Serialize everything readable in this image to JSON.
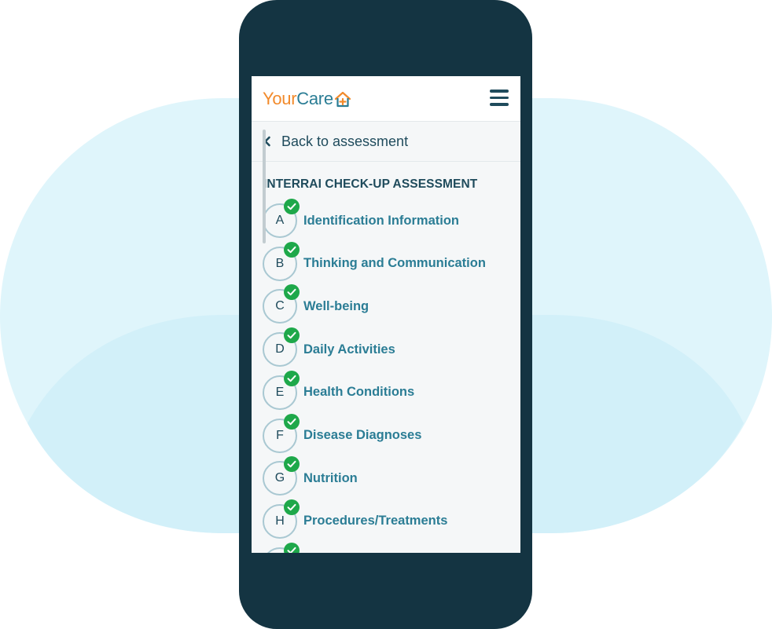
{
  "header": {
    "logo_text_part1": "Your",
    "logo_text_part2": "Care",
    "logo_icon": "house-plus-icon",
    "menu_icon": "hamburger-menu-icon"
  },
  "nav": {
    "back_label": "Back to assessment",
    "back_icon": "chevron-left-icon"
  },
  "assessment": {
    "title": "INTERRAI CHECK-UP ASSESSMENT",
    "sections": [
      {
        "letter": "A",
        "label": "Identification Information",
        "completed": true
      },
      {
        "letter": "B",
        "label": "Thinking and Communication",
        "completed": true
      },
      {
        "letter": "C",
        "label": "Well-being",
        "completed": true
      },
      {
        "letter": "D",
        "label": "Daily Activities",
        "completed": true
      },
      {
        "letter": "E",
        "label": "Health Conditions",
        "completed": true
      },
      {
        "letter": "F",
        "label": "Disease Diagnoses",
        "completed": true
      },
      {
        "letter": "G",
        "label": "Nutrition",
        "completed": true
      },
      {
        "letter": "H",
        "label": "Procedures/Treatments",
        "completed": true
      }
    ]
  },
  "colors": {
    "phone_frame": "#143442",
    "brand_orange": "#f28a2b",
    "brand_teal": "#2b7d95",
    "text_dark": "#1f4b5c",
    "completed_green": "#1ea84a",
    "backdrop_light": "#dff5fb",
    "backdrop_mid": "#d2f0f9"
  }
}
